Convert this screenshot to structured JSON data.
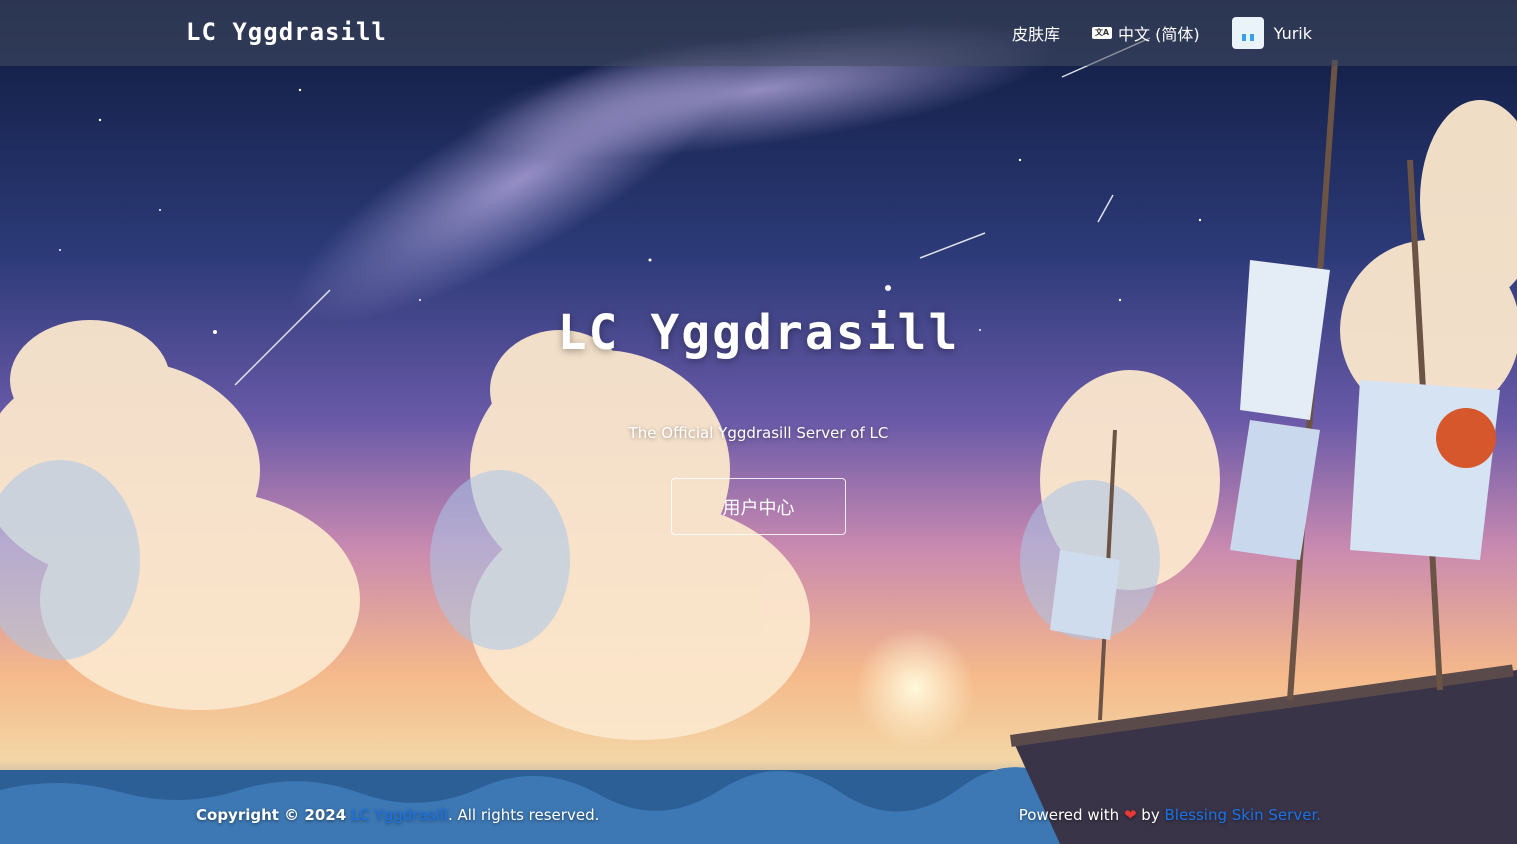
{
  "navbar": {
    "brand": "LC Yggdrasill",
    "skin_library": "皮肤库",
    "language": "中文 (简体)",
    "user_name": "Yurik"
  },
  "hero": {
    "title": "LC Yggdrasill",
    "subtitle": "The Official Yggdrasill Server of LC",
    "cta_label": "用户中心"
  },
  "footer": {
    "copyright_prefix": "Copyright © 2024",
    "site_link": "LC Yggdrasill",
    "rights": ". All rights reserved.",
    "powered_prefix": "Powered with",
    "heart": "❤",
    "powered_by": "by",
    "bs_link": "Blessing Skin Server."
  },
  "colors": {
    "link": "#1a73e8",
    "heart": "#e53935"
  }
}
